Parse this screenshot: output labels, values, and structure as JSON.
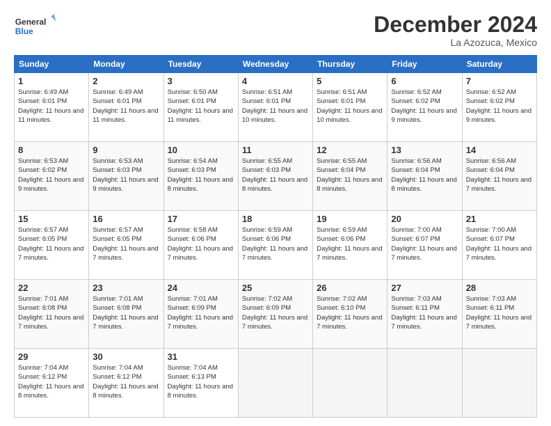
{
  "logo": {
    "line1": "General",
    "line2": "Blue"
  },
  "title": "December 2024",
  "subtitle": "La Azozuca, Mexico",
  "days_header": [
    "Sunday",
    "Monday",
    "Tuesday",
    "Wednesday",
    "Thursday",
    "Friday",
    "Saturday"
  ],
  "weeks": [
    [
      {
        "day": "1",
        "info": "Sunrise: 6:49 AM\nSunset: 6:01 PM\nDaylight: 11 hours and 11 minutes."
      },
      {
        "day": "2",
        "info": "Sunrise: 6:49 AM\nSunset: 6:01 PM\nDaylight: 11 hours and 11 minutes."
      },
      {
        "day": "3",
        "info": "Sunrise: 6:50 AM\nSunset: 6:01 PM\nDaylight: 11 hours and 11 minutes."
      },
      {
        "day": "4",
        "info": "Sunrise: 6:51 AM\nSunset: 6:01 PM\nDaylight: 11 hours and 10 minutes."
      },
      {
        "day": "5",
        "info": "Sunrise: 6:51 AM\nSunset: 6:01 PM\nDaylight: 11 hours and 10 minutes."
      },
      {
        "day": "6",
        "info": "Sunrise: 6:52 AM\nSunset: 6:02 PM\nDaylight: 11 hours and 9 minutes."
      },
      {
        "day": "7",
        "info": "Sunrise: 6:52 AM\nSunset: 6:02 PM\nDaylight: 11 hours and 9 minutes."
      }
    ],
    [
      {
        "day": "8",
        "info": "Sunrise: 6:53 AM\nSunset: 6:02 PM\nDaylight: 11 hours and 9 minutes."
      },
      {
        "day": "9",
        "info": "Sunrise: 6:53 AM\nSunset: 6:03 PM\nDaylight: 11 hours and 9 minutes."
      },
      {
        "day": "10",
        "info": "Sunrise: 6:54 AM\nSunset: 6:03 PM\nDaylight: 11 hours and 8 minutes."
      },
      {
        "day": "11",
        "info": "Sunrise: 6:55 AM\nSunset: 6:03 PM\nDaylight: 11 hours and 8 minutes."
      },
      {
        "day": "12",
        "info": "Sunrise: 6:55 AM\nSunset: 6:04 PM\nDaylight: 11 hours and 8 minutes."
      },
      {
        "day": "13",
        "info": "Sunrise: 6:56 AM\nSunset: 6:04 PM\nDaylight: 11 hours and 8 minutes."
      },
      {
        "day": "14",
        "info": "Sunrise: 6:56 AM\nSunset: 6:04 PM\nDaylight: 11 hours and 7 minutes."
      }
    ],
    [
      {
        "day": "15",
        "info": "Sunrise: 6:57 AM\nSunset: 6:05 PM\nDaylight: 11 hours and 7 minutes."
      },
      {
        "day": "16",
        "info": "Sunrise: 6:57 AM\nSunset: 6:05 PM\nDaylight: 11 hours and 7 minutes."
      },
      {
        "day": "17",
        "info": "Sunrise: 6:58 AM\nSunset: 6:06 PM\nDaylight: 11 hours and 7 minutes."
      },
      {
        "day": "18",
        "info": "Sunrise: 6:59 AM\nSunset: 6:06 PM\nDaylight: 11 hours and 7 minutes."
      },
      {
        "day": "19",
        "info": "Sunrise: 6:59 AM\nSunset: 6:06 PM\nDaylight: 11 hours and 7 minutes."
      },
      {
        "day": "20",
        "info": "Sunrise: 7:00 AM\nSunset: 6:07 PM\nDaylight: 11 hours and 7 minutes."
      },
      {
        "day": "21",
        "info": "Sunrise: 7:00 AM\nSunset: 6:07 PM\nDaylight: 11 hours and 7 minutes."
      }
    ],
    [
      {
        "day": "22",
        "info": "Sunrise: 7:01 AM\nSunset: 6:08 PM\nDaylight: 11 hours and 7 minutes."
      },
      {
        "day": "23",
        "info": "Sunrise: 7:01 AM\nSunset: 6:08 PM\nDaylight: 11 hours and 7 minutes."
      },
      {
        "day": "24",
        "info": "Sunrise: 7:01 AM\nSunset: 6:09 PM\nDaylight: 11 hours and 7 minutes."
      },
      {
        "day": "25",
        "info": "Sunrise: 7:02 AM\nSunset: 6:09 PM\nDaylight: 11 hours and 7 minutes."
      },
      {
        "day": "26",
        "info": "Sunrise: 7:02 AM\nSunset: 6:10 PM\nDaylight: 11 hours and 7 minutes."
      },
      {
        "day": "27",
        "info": "Sunrise: 7:03 AM\nSunset: 6:11 PM\nDaylight: 11 hours and 7 minutes."
      },
      {
        "day": "28",
        "info": "Sunrise: 7:03 AM\nSunset: 6:11 PM\nDaylight: 11 hours and 7 minutes."
      }
    ],
    [
      {
        "day": "29",
        "info": "Sunrise: 7:04 AM\nSunset: 6:12 PM\nDaylight: 11 hours and 8 minutes."
      },
      {
        "day": "30",
        "info": "Sunrise: 7:04 AM\nSunset: 6:12 PM\nDaylight: 11 hours and 8 minutes."
      },
      {
        "day": "31",
        "info": "Sunrise: 7:04 AM\nSunset: 6:13 PM\nDaylight: 11 hours and 8 minutes."
      },
      {
        "day": "",
        "info": ""
      },
      {
        "day": "",
        "info": ""
      },
      {
        "day": "",
        "info": ""
      },
      {
        "day": "",
        "info": ""
      }
    ]
  ]
}
